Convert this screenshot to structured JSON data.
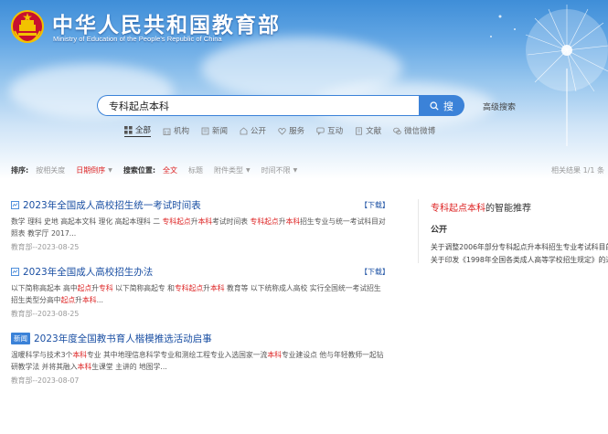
{
  "header": {
    "ministry_cn": "中华人民共和国教育部",
    "ministry_en": "Ministry of Education of the People's Republic of China"
  },
  "search": {
    "query": "专科起点本科",
    "button_label": "搜",
    "advanced_label": "高级搜索"
  },
  "categories": [
    {
      "label": "全部",
      "icon": "grid-icon",
      "active": true
    },
    {
      "label": "机构",
      "icon": "building-icon"
    },
    {
      "label": "新闻",
      "icon": "news-icon"
    },
    {
      "label": "公开",
      "icon": "public-icon"
    },
    {
      "label": "服务",
      "icon": "heart-icon"
    },
    {
      "label": "互动",
      "icon": "chat-icon"
    },
    {
      "label": "文献",
      "icon": "document-icon"
    },
    {
      "label": "微信微博",
      "icon": "wechat-icon"
    }
  ],
  "filters": {
    "sort_label": "排序:",
    "sort_relevance": "按相关度",
    "sort_date": "日期倒序",
    "position_label": "搜索位置:",
    "pos_full": "全文",
    "pos_title": "标题",
    "attachment": "附件类型",
    "time": "时间不限",
    "result_count": "相关结果 1/1 条"
  },
  "results": [
    {
      "badge": "doc-icon",
      "title": "2023年全国成人高校招生统一考试时间表",
      "download": "【下载】",
      "snippet": [
        {
          "t": "数学 理科 史地 高起本文科 理化 高起本理科 二 "
        },
        {
          "t": "专科起点",
          "hl": true
        },
        {
          "t": "升"
        },
        {
          "t": "本科",
          "hl": true
        },
        {
          "t": "考试时间表 "
        },
        {
          "t": "专科起点",
          "hl": true
        },
        {
          "t": "升"
        },
        {
          "t": "本科",
          "hl": true
        },
        {
          "t": "招生专业与统一考试科目对照表 教学厅 2017..."
        }
      ],
      "meta": "教育部--2023-08-25"
    },
    {
      "badge": "doc-icon",
      "title": "2023年全国成人高校招生办法",
      "download": "【下载】",
      "snippet": [
        {
          "t": "以下简称高起本 高中"
        },
        {
          "t": "起点",
          "hl": true
        },
        {
          "t": "升"
        },
        {
          "t": "专科",
          "hl": true
        },
        {
          "t": " 以下简称高起专 和"
        },
        {
          "t": "专科起点",
          "hl": true
        },
        {
          "t": "升"
        },
        {
          "t": "本科",
          "hl": true
        },
        {
          "t": " 教育等 以下统称成人高校 实行全国统一考试招生 招生类型分高中"
        },
        {
          "t": "起点",
          "hl": true
        },
        {
          "t": "升"
        },
        {
          "t": "本科",
          "hl": true
        },
        {
          "t": "..."
        }
      ],
      "meta": "教育部--2023-08-25"
    },
    {
      "badge": "news",
      "badge_label": "新闻",
      "title": "2023年度全国教书育人楷模推选活动启事",
      "download": "",
      "snippet": [
        {
          "t": "温暖科学与技术3个"
        },
        {
          "t": "本科",
          "hl": true
        },
        {
          "t": "专业 其中地理信息科学专业和测绘工程专业入选国家一流"
        },
        {
          "t": "本科",
          "hl": true
        },
        {
          "t": "专业建设点 他与年轻教师一起钻研教学法 并将其融入"
        },
        {
          "t": "本科",
          "hl": true
        },
        {
          "t": "生课堂 主讲的 地图学..."
        }
      ],
      "meta": "教育部--2023-08-07"
    }
  ],
  "sidebar": {
    "title_hl": "专科起点本科",
    "title_rest": "的智能推荐",
    "subtitle": "公开",
    "links": [
      "关于调整2006年部分专科起点升本科招生专业考试科目的通知",
      "关于印发《1998年全国各类成人高等学校招生规定》的通知"
    ]
  },
  "colors": {
    "accent": "#3b82d8",
    "link": "#1a4fa3",
    "highlight": "#dd2222"
  }
}
